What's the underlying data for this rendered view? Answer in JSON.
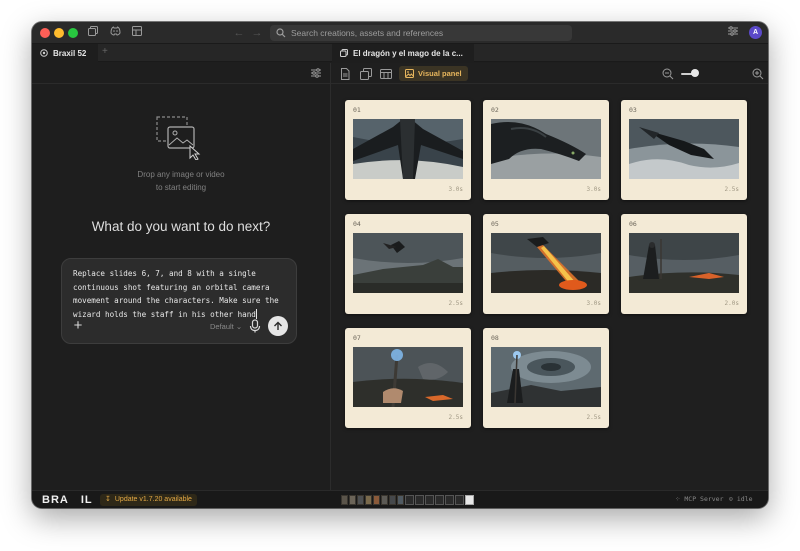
{
  "search": {
    "placeholder": "Search creations, assets and references"
  },
  "user": {
    "avatar_letter": "A"
  },
  "tabs": {
    "left": {
      "label": "Braxil 52"
    },
    "right": {
      "label": "El dragón y el mago de la c..."
    }
  },
  "left_pane": {
    "drop_hint_line1": "Drop any image or video",
    "drop_hint_line2": "to start editing",
    "heading": "What do you want to do next?",
    "composer_text": "Replace slides 6, 7, and 8 with a single continuous shot featuring an orbital camera movement around the characters. Make sure the wizard holds the staff in his other hand",
    "model_label": "Default"
  },
  "right_pane": {
    "visual_panel_label": "Visual panel"
  },
  "slides": [
    {
      "number": "01",
      "duration": "3.0s",
      "scene": "dragon-wings-up"
    },
    {
      "number": "02",
      "duration": "3.0s",
      "scene": "dragon-head"
    },
    {
      "number": "03",
      "duration": "2.5s",
      "scene": "dragon-sea"
    },
    {
      "number": "04",
      "duration": "2.5s",
      "scene": "dragon-distant"
    },
    {
      "number": "05",
      "duration": "3.0s",
      "scene": "dragon-fire"
    },
    {
      "number": "06",
      "duration": "2.0s",
      "scene": "wizard-fire"
    },
    {
      "number": "07",
      "duration": "2.5s",
      "scene": "staff-hand"
    },
    {
      "number": "08",
      "duration": "2.5s",
      "scene": "wizard-vortex"
    }
  ],
  "status": {
    "logo": "BRA IL",
    "update": "Update v1.7.20 available",
    "mcp": "MCP Server",
    "state": "idle"
  },
  "colors": {
    "accent": "#e7b65d",
    "slide_bg": "#f3ead6",
    "window_bg": "#1e1e1e"
  }
}
